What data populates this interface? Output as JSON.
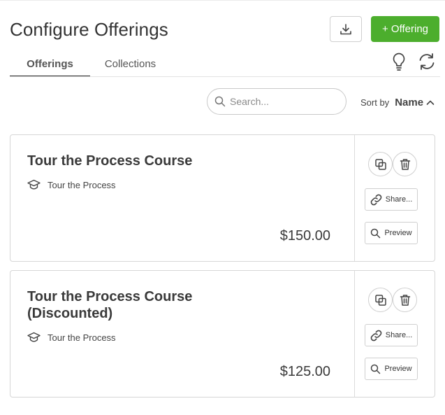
{
  "header": {
    "title": "Configure Offerings",
    "add_label": "+ Offering"
  },
  "tabs": [
    {
      "label": "Offerings",
      "active": true
    },
    {
      "label": "Collections",
      "active": false
    }
  ],
  "search": {
    "placeholder": "Search...",
    "value": ""
  },
  "sort": {
    "label": "Sort by",
    "value": "Name",
    "direction": "ascending"
  },
  "offerings": [
    {
      "name": "Tour the Process Course",
      "course": "Tour the Process",
      "price": "$150.00",
      "share_label": "Share...",
      "preview_label": "Preview"
    },
    {
      "name": "Tour the Process Course (Discounted)",
      "course": "Tour the Process",
      "price": "$125.00",
      "share_label": "Share...",
      "preview_label": "Preview"
    }
  ],
  "colors": {
    "accent": "#4cae2d",
    "text": "#333333",
    "border": "#d6d6d6"
  },
  "icons": [
    "download-icon",
    "lightbulb-icon",
    "refresh-icon",
    "search-icon",
    "graduation-cap-icon",
    "duplicate-icon",
    "trash-icon",
    "link-icon",
    "magnifier-icon",
    "chevron-up-icon"
  ]
}
